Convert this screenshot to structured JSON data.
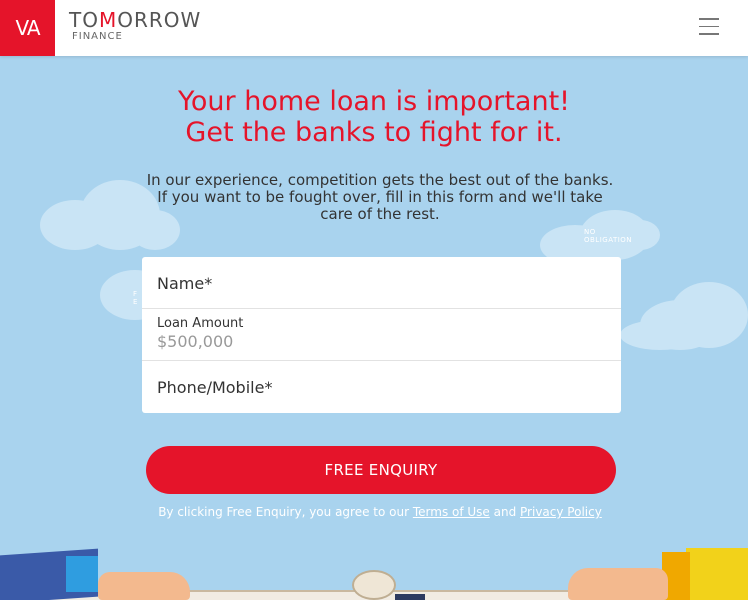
{
  "header": {
    "logo_mark": "VA",
    "brand_prefix": "TO",
    "brand_highlight": "M",
    "brand_suffix": "ORROW",
    "brand_sub": "FINANCE"
  },
  "hero": {
    "headline_line1": "Your home loan is important!",
    "headline_line2": "Get the banks to fight for it.",
    "intro": "In our experience, competition gets the best out of the banks. If you want to be fought over, fill in this form and we'll take care of the rest."
  },
  "badges": {
    "right_line1": "NO",
    "right_line2": "OBLIGATION",
    "left_line1": "F",
    "left_line2": "E"
  },
  "form": {
    "name_label": "Name*",
    "loan_label": "Loan Amount",
    "loan_value": "$500,000",
    "phone_label": "Phone/Mobile*"
  },
  "cta": {
    "button_label": "FREE ENQUIRY"
  },
  "legal": {
    "prefix": "By clicking Free Enquiry, you agree to our ",
    "terms_link": "Terms of Use",
    "middle": " and ",
    "privacy_link": "Privacy Policy"
  },
  "colors": {
    "brand_red": "#e5142a",
    "sky": "#a9d3ee"
  }
}
